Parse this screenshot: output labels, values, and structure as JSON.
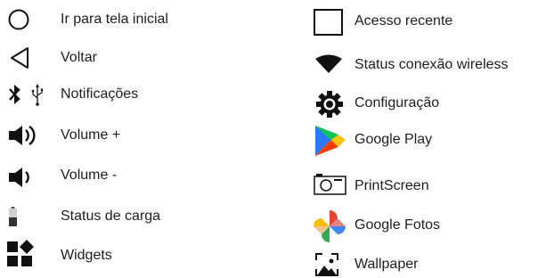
{
  "legend": {
    "left": [
      {
        "icon": "circle-outline-icon",
        "label": "Ir para tela inicial"
      },
      {
        "icon": "triangle-back-icon",
        "label": "Voltar"
      },
      {
        "icon": "bluetooth-usb-icon",
        "label": "Notificações"
      },
      {
        "icon": "volume-up-icon",
        "label": "Volume +"
      },
      {
        "icon": "volume-down-icon",
        "label": "Volume -"
      },
      {
        "icon": "battery-icon",
        "label": "Status de carga"
      },
      {
        "icon": "widgets-icon",
        "label": "Widgets"
      }
    ],
    "right": [
      {
        "icon": "square-outline-icon",
        "label": "Acesso recente"
      },
      {
        "icon": "wifi-signal-icon",
        "label": "Status conexão wireless"
      },
      {
        "icon": "gear-icon",
        "label": "Configuração"
      },
      {
        "icon": "google-play-icon",
        "label": "Google Play"
      },
      {
        "icon": "camera-icon",
        "label": "PrintScreen"
      },
      {
        "icon": "google-photos-icon",
        "label": "Google Fotos"
      },
      {
        "icon": "wallpaper-icon",
        "label": "Wallpaper"
      }
    ]
  },
  "colors": {
    "text": "#1e1e1e",
    "icon": "#111111",
    "play_green": "#00c853",
    "play_blue": "#2979ff",
    "play_red": "#ff3d00",
    "play_yellow": "#ffc400",
    "photos_red": "#ea4335",
    "photos_yellow": "#fbbc05",
    "photos_green": "#34a853",
    "photos_blue": "#4285f4"
  }
}
